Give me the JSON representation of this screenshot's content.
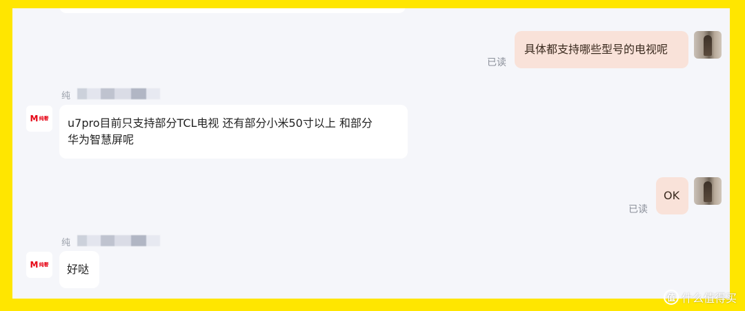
{
  "messages": [
    {
      "id": "out1",
      "text": "具体都支持哪些型号的电视呢",
      "status": "已读"
    },
    {
      "id": "in1",
      "sender": "纯",
      "text_line1": "u7pro目前只支持部分TCL电视 还有部分小米50寸以上 和部分",
      "text_line2": "华为智慧屏呢"
    },
    {
      "id": "out2",
      "text": "OK",
      "status": "已读"
    },
    {
      "id": "in2",
      "sender": "纯",
      "text": "好哒"
    }
  ],
  "logo": {
    "mark": "M",
    "text": "纯奢"
  },
  "watermark": {
    "icon": "值",
    "text": "什么值得买"
  },
  "colors": {
    "frame": "#ffe600",
    "chat_bg": "#f5f6fa",
    "out_bubble": "#f9e2d9",
    "in_bubble": "#ffffff",
    "logo_red": "#e60012"
  }
}
